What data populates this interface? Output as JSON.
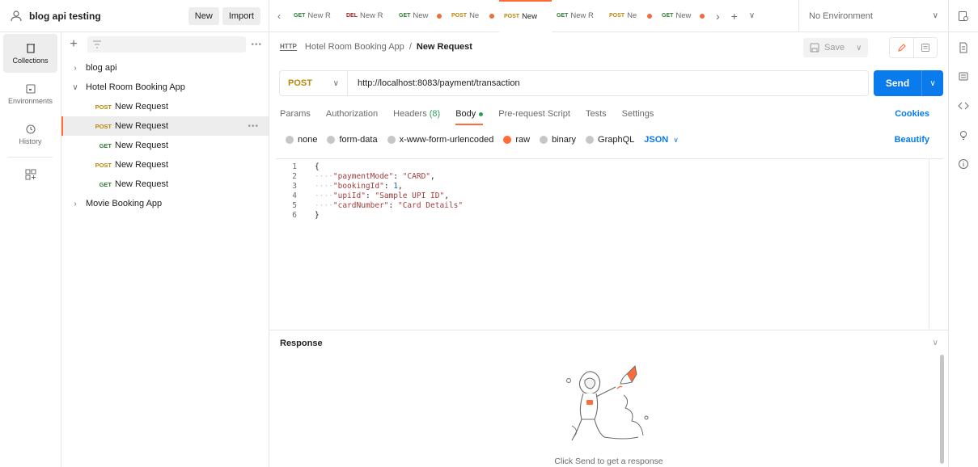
{
  "workspace": {
    "name": "blog api testing",
    "new_label": "New",
    "import_label": "Import"
  },
  "tabs": [
    {
      "method": "GET",
      "name": "New R",
      "dot": false,
      "active": false
    },
    {
      "method": "DEL",
      "name": "New R",
      "dot": false,
      "active": false
    },
    {
      "method": "GET",
      "name": "New",
      "dot": true,
      "active": false
    },
    {
      "method": "POST",
      "name": "Ne",
      "dot": true,
      "active": false
    },
    {
      "method": "POST",
      "name": "New",
      "dot": false,
      "active": true
    },
    {
      "method": "GET",
      "name": "New R",
      "dot": false,
      "active": false
    },
    {
      "method": "POST",
      "name": "Ne",
      "dot": true,
      "active": false
    },
    {
      "method": "GET",
      "name": "New",
      "dot": true,
      "active": false
    }
  ],
  "environment": {
    "label": "No Environment"
  },
  "rail": {
    "collections": "Collections",
    "environments": "Environments",
    "history": "History"
  },
  "tree": {
    "items": [
      {
        "type": "folder",
        "label": "blog api",
        "open": false
      },
      {
        "type": "folder",
        "label": "Hotel Room Booking App",
        "open": true
      },
      {
        "type": "req",
        "method": "POST",
        "label": "New Request",
        "selected": false
      },
      {
        "type": "req",
        "method": "POST",
        "label": "New Request",
        "selected": true
      },
      {
        "type": "req",
        "method": "GET",
        "label": "New Request",
        "selected": false
      },
      {
        "type": "req",
        "method": "POST",
        "label": "New Request",
        "selected": false
      },
      {
        "type": "req",
        "method": "GET",
        "label": "New Request",
        "selected": false
      },
      {
        "type": "folder",
        "label": "Movie Booking App",
        "open": false
      }
    ]
  },
  "breadcrumb": {
    "icon_text": "HTTP",
    "collection": "Hotel Room Booking App",
    "separator": "/",
    "current": "New Request"
  },
  "save": {
    "label": "Save"
  },
  "request": {
    "method": "POST",
    "url": "http://localhost:8083/payment/transaction",
    "send_label": "Send"
  },
  "req_tabs": {
    "params": "Params",
    "authorization": "Authorization",
    "headers": "Headers",
    "headers_count": "(8)",
    "body": "Body",
    "prerequest": "Pre-request Script",
    "tests": "Tests",
    "settings": "Settings",
    "cookies": "Cookies"
  },
  "body_options": {
    "none": "none",
    "form_data": "form-data",
    "urlencoded": "x-www-form-urlencoded",
    "raw": "raw",
    "binary": "binary",
    "graphql": "GraphQL",
    "format": "JSON",
    "beautify": "Beautify"
  },
  "code": {
    "line_numbers": [
      "1",
      "2",
      "3",
      "4",
      "5",
      "6"
    ],
    "open_brace": "{",
    "close_brace": "}",
    "indent": "····",
    "lines": [
      {
        "key": "\"paymentMode\"",
        "value": "\"CARD\"",
        "kind": "s",
        "comma": ","
      },
      {
        "key": "\"bookingId\"",
        "value": "1",
        "kind": "n",
        "comma": ","
      },
      {
        "key": "\"upiId\"",
        "value": "\"Sample UPI ID\"",
        "kind": "s",
        "comma": ","
      },
      {
        "key": "\"cardNumber\"",
        "value": "\"Card Details\"",
        "kind": "s",
        "comma": ""
      }
    ]
  },
  "response": {
    "title": "Response",
    "hint": "Click Send to get a response"
  },
  "colors": {
    "accent": "#ff6c37",
    "send_blue": "#097bed",
    "get_green": "#2e7d32",
    "post_gold": "#b8860b",
    "del_red": "#a61e1e"
  }
}
